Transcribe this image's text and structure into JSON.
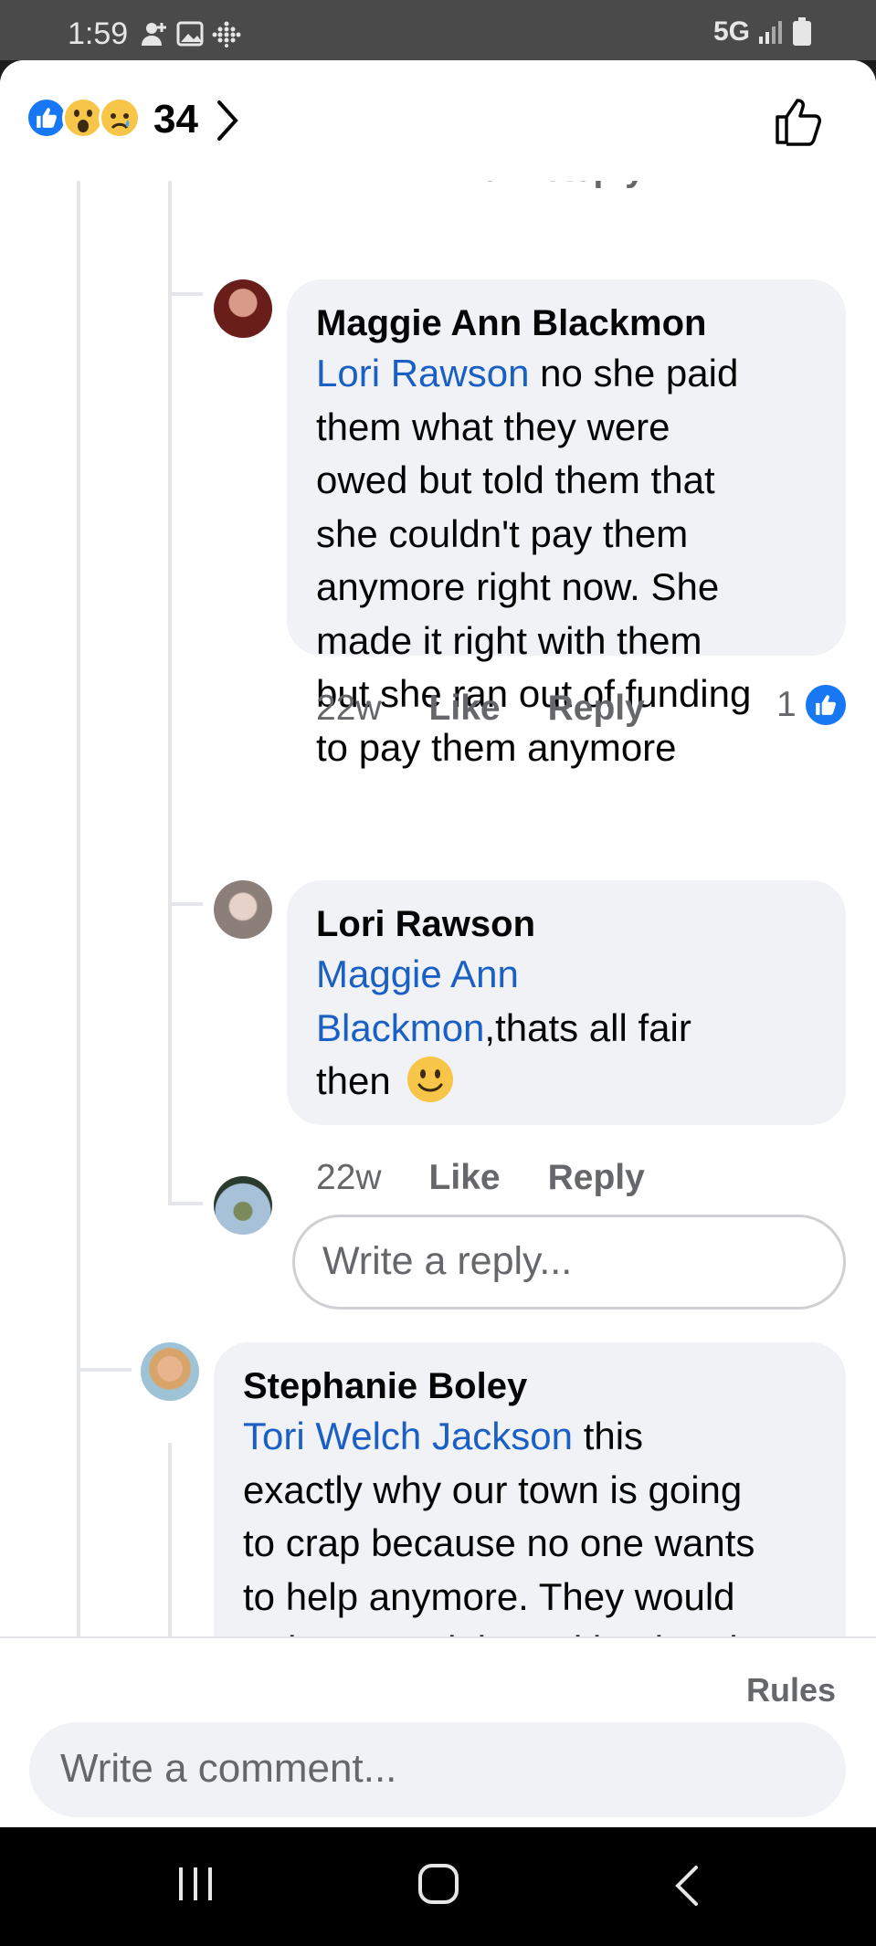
{
  "status_bar": {
    "time": "1:59",
    "network": "5G",
    "left_icons": [
      "add-person-icon",
      "image-icon",
      "dots-grid-icon"
    ],
    "right_icons": [
      "signal-icon",
      "battery-icon"
    ]
  },
  "header": {
    "reactions": [
      "like",
      "wow",
      "sad"
    ],
    "reaction_count": "34",
    "like_button_icon": "thumbs-up-icon"
  },
  "comments": [
    {
      "author": "Maggie Ann Blackmon",
      "mention": "Lori Rawson",
      "text_lines": [
        " no she paid",
        "them what they were",
        "owed but told them that",
        "she couldn't pay them",
        "anymore right now. She",
        "made it right with them",
        "but she ran out of funding",
        "to pay them anymore"
      ],
      "time": "22w",
      "like": "Like",
      "reply": "Reply",
      "reaction_count": "1"
    },
    {
      "author": "Lori Rawson",
      "mention_lines": [
        "Maggie Ann",
        "Blackmon"
      ],
      "text_after": ",thats all fair",
      "text_last": "then",
      "emoji": "smile",
      "time": "22w",
      "like": "Like",
      "reply": "Reply"
    },
    {
      "author": "Stephanie Boley",
      "mention": "Tori Welch Jackson",
      "text_lines": [
        " this",
        "exactly why our town is going",
        "to crap because no one wants",
        "to help anymore. They would",
        "rather complain and bash ppl."
      ]
    }
  ],
  "reply_input": {
    "placeholder": "Write a reply..."
  },
  "footer": {
    "rules": "Rules",
    "comment_placeholder": "Write a comment..."
  },
  "nav": [
    "recent-apps-icon",
    "home-icon",
    "back-icon"
  ]
}
